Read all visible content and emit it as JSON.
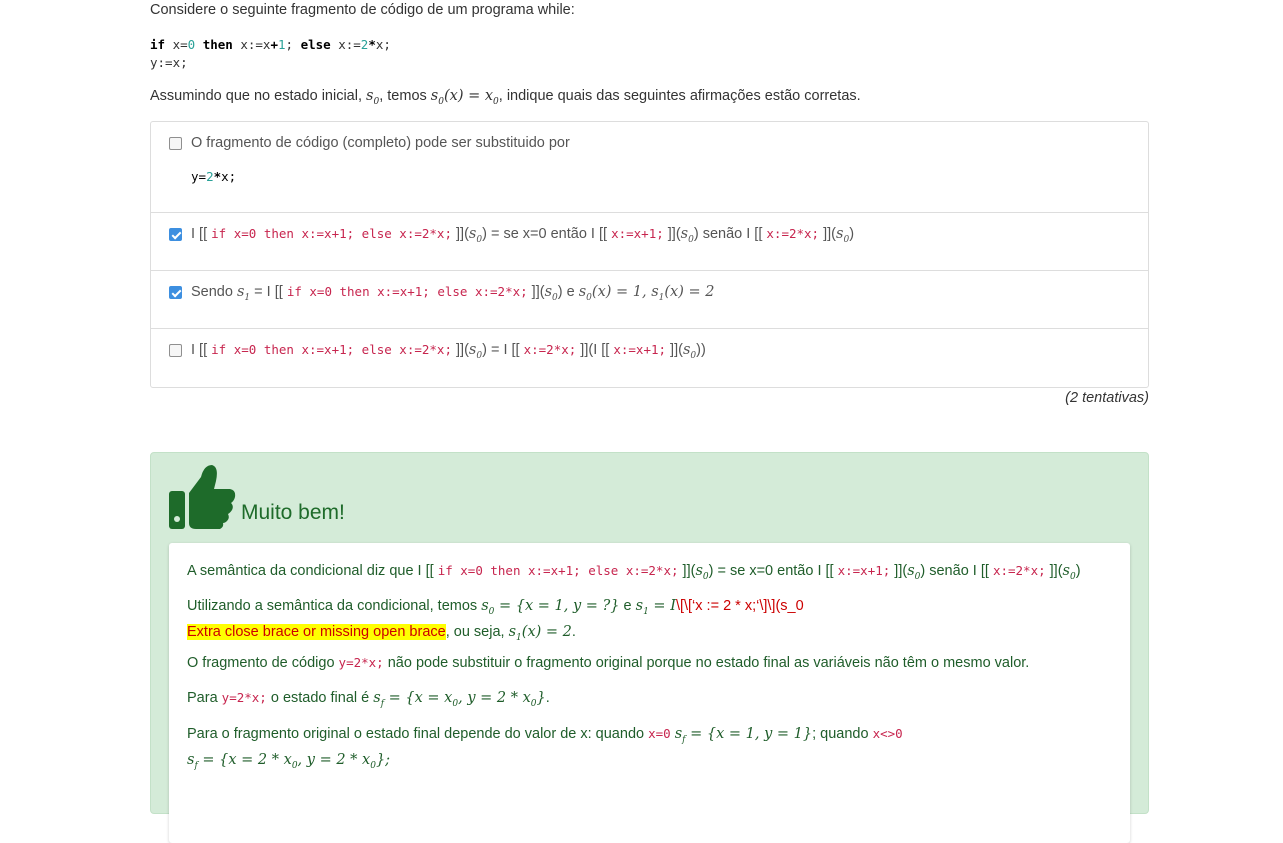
{
  "question": {
    "intro": "Considere o seguinte fragmento de código de um programa while:",
    "assume_pre": "Assumindo que no estado inicial,",
    "assume_mid": ", temos",
    "assume_post": ", indique quais das seguintes afirmações estão corretas.",
    "s0": "s",
    "s0_sub": "0",
    "s0x": "s",
    "s0x_rest": "(x) = x",
    "s0x_sub2": "0"
  },
  "options": [
    {
      "text": "O fragmento de código (completo) pode ser substituido por",
      "checked": false
    },
    {
      "checked": true
    },
    {
      "checked": true,
      "sendo": "Sendo",
      "eq_rest": "= I [[",
      "e": "e"
    },
    {
      "checked": false
    }
  ],
  "code": {
    "cond": "if x=0 then x:=x+1; else x:=2*x;",
    "then_branch": "x:=x+1;",
    "else_branch": "x:=2*x;",
    "subst": "y=2*x;",
    "cond_x0": "x=0",
    "cond_xne0": "x<>0"
  },
  "attempts": "(2 tentativas)",
  "feedback": {
    "title": "Muito bem!",
    "p1_pre": "A semântica da condicional diz que I [[",
    "p1_mid": "]](",
    "p1_rest1": ") = se x=0 então I [[",
    "p1_rest2": ") senão I [[",
    "p2_pre": "Utilizando a semântica da condicional, temos",
    "p2_err_raw": "\\[\\[‘x := 2 * x;‘\\]\\](s_0",
    "p2_error": "Extra close brace or missing open brace",
    "p2_post": ", ou seja,",
    "p3_pre": "O fragmento de código",
    "p3_post": "não pode substituir o fragmento original porque no estado final as variáveis não têm o mesmo valor.",
    "p4_pre": "Para",
    "p4_mid": "o estado final é",
    "p5_pre": "Para o fragmento original o estado final depende do valor de x: quando",
    "p5_mid": "; quando"
  }
}
